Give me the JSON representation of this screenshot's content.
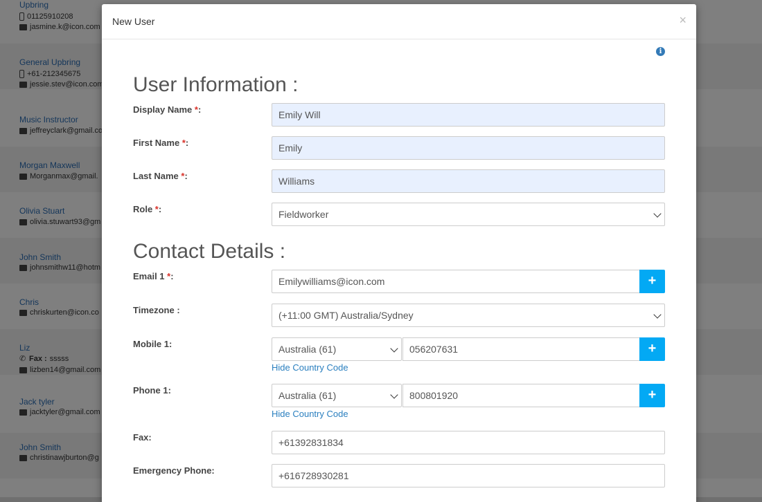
{
  "background_list": [
    {
      "name": "Upbring",
      "lines": [
        {
          "icon": "mobile-icon",
          "text": "01125910208"
        },
        {
          "icon": "envelope-icon",
          "text": "jasmine.k@icon.com"
        }
      ]
    },
    {
      "name": "General Upbring",
      "lines": [
        {
          "icon": "mobile-icon",
          "text": "+61-212345675"
        },
        {
          "icon": "envelope-icon",
          "text": "jessie.stev@icon.com"
        }
      ]
    },
    {
      "name": "Music Instructor",
      "lines": [
        {
          "icon": "envelope-icon",
          "text": "jeffreyclark@gmail.co"
        }
      ]
    },
    {
      "name": "Morgan Maxwell",
      "lines": [
        {
          "icon": "envelope-icon",
          "text": "Morganmax@gmail."
        }
      ]
    },
    {
      "name": "Olivia Stuart",
      "lines": [
        {
          "icon": "envelope-icon",
          "text": "olivia.stuwart93@gm"
        }
      ]
    },
    {
      "name": "John Smith",
      "lines": [
        {
          "icon": "envelope-icon",
          "text": "johnsmithw11@hotm"
        }
      ]
    },
    {
      "name": "Chris",
      "lines": [
        {
          "icon": "envelope-icon",
          "text": "chriskurten@icon.co"
        }
      ]
    },
    {
      "name": "Liz",
      "lines": [
        {
          "icon": "phone-icon",
          "label": "Fax :",
          "text": "sssss"
        },
        {
          "icon": "envelope-icon",
          "text": "lizben14@gmail.com"
        }
      ]
    },
    {
      "name": "Jack tyler",
      "lines": [
        {
          "icon": "envelope-icon",
          "text": "jacktyler@gmail.com"
        }
      ]
    },
    {
      "name": "John Smith",
      "lines": [
        {
          "icon": "envelope-icon",
          "text": "christinawjburton@g"
        }
      ]
    }
  ],
  "modal": {
    "title": "New User",
    "close": "×",
    "info": "i",
    "sections": {
      "user_info": "User Information :",
      "contact": "Contact Details :"
    },
    "fields": {
      "display_name": {
        "label": "Display Name ",
        "req": "*",
        "suffix": ":",
        "value": "Emily Will"
      },
      "first_name": {
        "label": "First Name ",
        "req": "*",
        "suffix": ":",
        "value": "Emily"
      },
      "last_name": {
        "label": "Last Name ",
        "req": "*",
        "suffix": ":",
        "value": "Williams"
      },
      "role": {
        "label": "Role ",
        "req": "*",
        "suffix": ":",
        "value": "Fieldworker"
      },
      "email1": {
        "label": "Email 1 ",
        "req": "*",
        "suffix": ":",
        "value": "Emilywilliams@icon.com",
        "add": "+"
      },
      "timezone": {
        "label": "Timezone :",
        "value": "(+11:00 GMT) Australia/Sydney"
      },
      "mobile1": {
        "label": "Mobile 1:",
        "country": "Australia (61)",
        "value": "056207631",
        "add": "+",
        "hide_link": "Hide Country Code"
      },
      "phone1": {
        "label": "Phone 1:",
        "country": "Australia (61)",
        "value": "800801920",
        "add": "+",
        "hide_link": "Hide Country Code"
      },
      "fax": {
        "label": "Fax:",
        "value": "+61392831834"
      },
      "emergency": {
        "label": "Emergency Phone:",
        "value": "+616728930281"
      }
    }
  }
}
